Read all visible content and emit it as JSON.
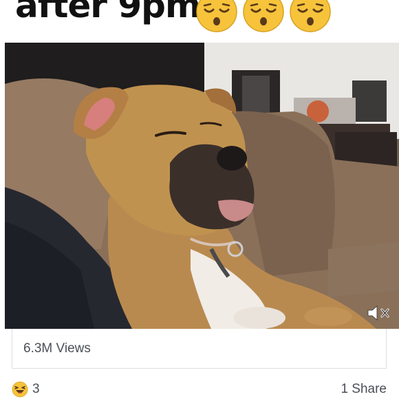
{
  "post": {
    "caption": "after 9pm",
    "caption_emoji": [
      "sleepy-face-icon",
      "sleepy-face-icon",
      "sleepy-face-icon"
    ]
  },
  "video": {
    "content": "boxer-dog-sleeping-on-couch",
    "muted": true,
    "mute_icon": "speaker-muted-icon"
  },
  "stats": {
    "views": "6.3M Views",
    "reaction_icon": "haha-reaction-icon",
    "reaction_count": "3",
    "shares": "1 Share"
  },
  "colors": {
    "emoji_yellow": "#f6c33b",
    "text_dark": "#111111",
    "meta_gray": "#4b4f56",
    "border_gray": "#dadde1"
  }
}
